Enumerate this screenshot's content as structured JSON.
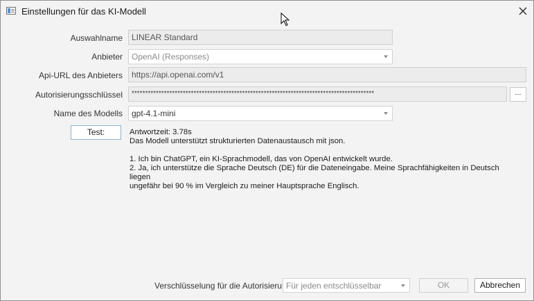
{
  "window": {
    "title": "Einstellungen für das KI-Modell"
  },
  "form": {
    "auswahlname": {
      "label": "Auswahlname",
      "value": "LINEAR Standard"
    },
    "anbieter": {
      "label": "Anbieter",
      "value": "OpenAI (Responses)"
    },
    "api_url": {
      "label": "Api-URL des Anbieters",
      "value": "https://api.openai.com/v1"
    },
    "auth_key": {
      "label": "Autorisierungsschlüssel",
      "value": "******************************************************************************************",
      "button_label": "..."
    },
    "model": {
      "label": "Name des Modells",
      "value": "gpt-4.1-mini"
    }
  },
  "test": {
    "button_label": "Test:",
    "lines": [
      "Antwortzeit: 3.78s",
      "Das Modell unterstützt strukturierten Datenaustausch mit json.",
      "",
      "1. Ich bin ChatGPT, ein KI-Sprachmodell, das von OpenAI entwickelt wurde.",
      "2. Ja, ich unterstütze die Sprache Deutsch (DE) für die Dateneingabe. Meine Sprachfähigkeiten in Deutsch liegen",
      "ungefähr bei 90 % im Vergleich zu meiner Hauptsprache Englisch."
    ]
  },
  "footer": {
    "encryption_label": "Verschlüsselung für die Autorisierung",
    "encryption_value": "Für jeden entschlüsselbar",
    "ok_label": "OK",
    "cancel_label": "Abbrechen"
  }
}
